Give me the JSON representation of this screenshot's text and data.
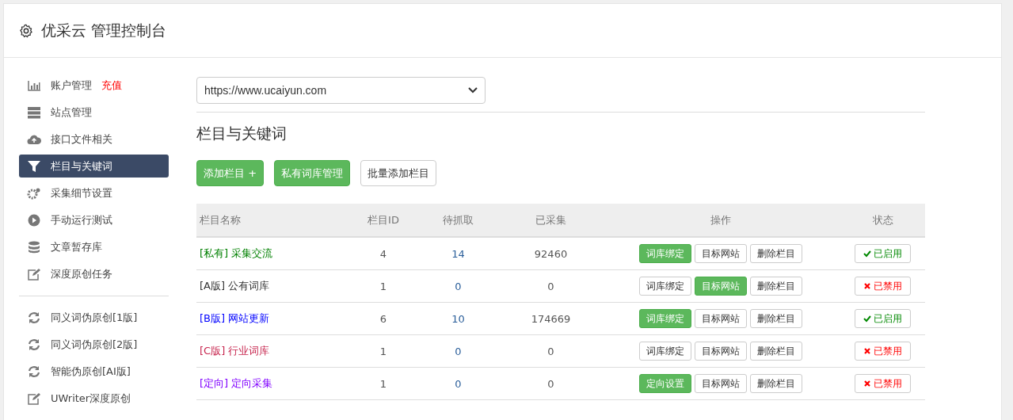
{
  "header": {
    "title": "优采云 管理控制台"
  },
  "sidebar": {
    "items": [
      {
        "label": "账户管理",
        "badge": "充值",
        "selected": false
      },
      {
        "label": "站点管理",
        "selected": false
      },
      {
        "label": "接口文件相关",
        "selected": false
      },
      {
        "label": "栏目与关键词",
        "selected": true
      },
      {
        "label": "采集细节设置",
        "selected": false
      },
      {
        "label": "手动运行测试",
        "selected": false
      },
      {
        "label": "文章暂存库",
        "selected": false
      },
      {
        "label": "深度原创任务",
        "selected": false,
        "divider_after": true
      },
      {
        "label": "同义词伪原创[1版]",
        "selected": false
      },
      {
        "label": "同义词伪原创[2版]",
        "selected": false
      },
      {
        "label": "智能伪原创[AI版]",
        "selected": false
      },
      {
        "label": "UWriter深度原创",
        "selected": false
      }
    ]
  },
  "site_select": {
    "value": "https://www.ucaiyun.com"
  },
  "section_title": "栏目与关键词",
  "toolbar": [
    {
      "label": "添加栏目 +",
      "primary": true
    },
    {
      "label": "私有词库管理",
      "primary": true
    },
    {
      "label": "批量添加栏目",
      "primary": false
    }
  ],
  "table": {
    "columns": [
      "栏目名称",
      "栏目ID",
      "待抓取",
      "已采集",
      "操作",
      "状态"
    ],
    "rows": [
      {
        "tag": "[私有]",
        "name": "采集交流",
        "color": "#008000",
        "id": "4",
        "pending": "14",
        "collected": "92460",
        "actions": [
          {
            "label": "词库绑定",
            "primary": true
          },
          {
            "label": "目标网站",
            "primary": false
          },
          {
            "label": "删除栏目",
            "primary": false
          }
        ],
        "status": {
          "label": "已启用",
          "enabled": true
        }
      },
      {
        "tag": "[A版]",
        "name": "公有词库",
        "color": "#333333",
        "id": "1",
        "pending": "0",
        "collected": "0",
        "actions": [
          {
            "label": "词库绑定",
            "primary": false
          },
          {
            "label": "目标网站",
            "primary": true
          },
          {
            "label": "删除栏目",
            "primary": false
          }
        ],
        "status": {
          "label": "已禁用",
          "enabled": false
        }
      },
      {
        "tag": "[B版]",
        "name": "网站更新",
        "color": "#0000ff",
        "id": "6",
        "pending": "10",
        "collected": "174669",
        "actions": [
          {
            "label": "词库绑定",
            "primary": true
          },
          {
            "label": "目标网站",
            "primary": false
          },
          {
            "label": "删除栏目",
            "primary": false
          }
        ],
        "status": {
          "label": "已启用",
          "enabled": true
        }
      },
      {
        "tag": "[C版]",
        "name": "行业词库",
        "color": "#c7254e",
        "id": "1",
        "pending": "0",
        "collected": "0",
        "actions": [
          {
            "label": "词库绑定",
            "primary": false
          },
          {
            "label": "目标网站",
            "primary": false
          },
          {
            "label": "删除栏目",
            "primary": false
          }
        ],
        "status": {
          "label": "已禁用",
          "enabled": false
        }
      },
      {
        "tag": "[定向]",
        "name": "定向采集",
        "color": "#8000ff",
        "id": "1",
        "pending": "0",
        "collected": "0",
        "actions": [
          {
            "label": "定向设置",
            "primary": true
          },
          {
            "label": "目标网站",
            "primary": false
          },
          {
            "label": "删除栏目",
            "primary": false
          }
        ],
        "status": {
          "label": "已禁用",
          "enabled": false
        }
      }
    ]
  }
}
